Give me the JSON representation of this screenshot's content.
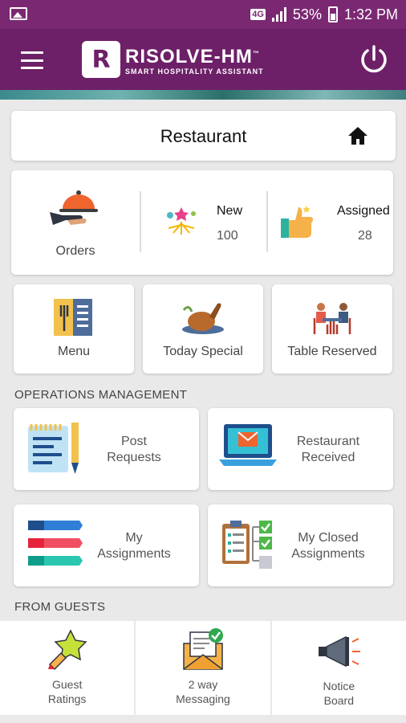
{
  "status_bar": {
    "network": "4G",
    "battery": "53%",
    "time": "1:32 PM"
  },
  "app_bar": {
    "logo_letter": "R",
    "brand": "RISOLVE-HM",
    "tagline": "SMART HOSPITALITY ASSISTANT",
    "trademark": "™"
  },
  "header": {
    "title": "Restaurant"
  },
  "orders_card": {
    "orders_label": "Orders",
    "new_label": "New",
    "new_count": "100",
    "assigned_label": "Assigned",
    "assigned_count": "28"
  },
  "quick_tiles": [
    {
      "label": "Menu",
      "icon": "menu-icon"
    },
    {
      "label": "Today Special",
      "icon": "chicken-icon"
    },
    {
      "label": "Table Reserved",
      "icon": "dining-table-icon"
    }
  ],
  "operations": {
    "heading": "OPERATIONS MANAGEMENT",
    "items": [
      {
        "line1": "Post",
        "line2": "Requests",
        "icon": "notepad-pencil-icon"
      },
      {
        "line1": "Restaurant",
        "line2": "Received",
        "icon": "laptop-mail-icon"
      },
      {
        "line1": "My",
        "line2": "Assignments",
        "icon": "numbered-list-icon"
      },
      {
        "line1": "My Closed",
        "line2": "Assignments",
        "icon": "checklist-icon"
      }
    ]
  },
  "guests": {
    "heading": "FROM GUESTS",
    "items": [
      {
        "line1": "Guest",
        "line2": "Ratings",
        "icon": "star-rating-icon"
      },
      {
        "line1": "2 way",
        "line2": "Messaging",
        "icon": "envelope-check-icon"
      },
      {
        "line1": "Notice",
        "line2": "Board",
        "icon": "megaphone-icon"
      }
    ]
  },
  "colors": {
    "brand_purple": "#6d2068",
    "status_purple": "#7b2873",
    "background": "#e9e9e9"
  }
}
